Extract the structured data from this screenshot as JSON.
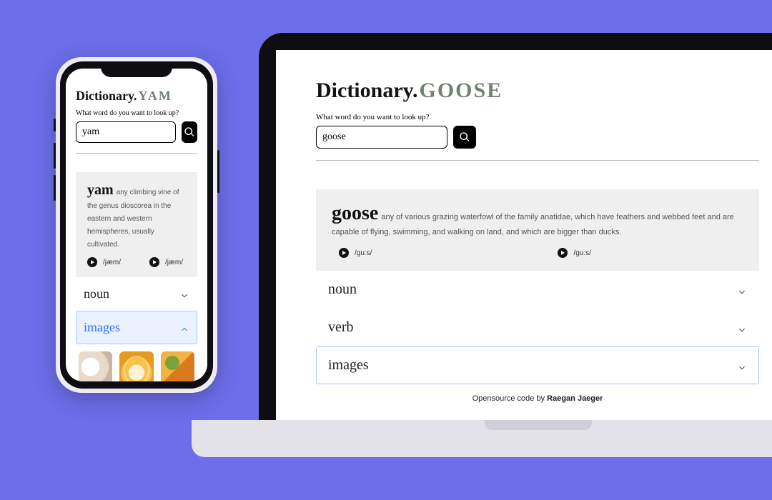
{
  "phone": {
    "brand_main": "Dictionary.",
    "brand_word": "YAM",
    "prompt": "What word do you want to look up?",
    "search_value": "yam",
    "def_word": "yam",
    "def_text": "any climbing vine of the genus dioscorea in the eastern and western hemispheres, usually cultivated.",
    "pron1": "/jæm/",
    "pron2": "/jæm/",
    "section_noun": "noun",
    "section_images": "images"
  },
  "laptop": {
    "brand_main": "Dictionary.",
    "brand_word": "GOOSE",
    "prompt": "What word do you want to look up?",
    "search_value": "goose",
    "def_word": "goose",
    "def_text": "any of various grazing waterfowl of the family anatidae, which have feathers and webbed feet and are capable of flying, swimming, and walking on land, and which are bigger than ducks.",
    "pron1": "/guːs/",
    "pron2": "/guːs/",
    "section_noun": "noun",
    "section_verb": "verb",
    "section_images": "images",
    "footer_prefix": "Opensource code by ",
    "footer_author": "Raegan Jaeger"
  }
}
